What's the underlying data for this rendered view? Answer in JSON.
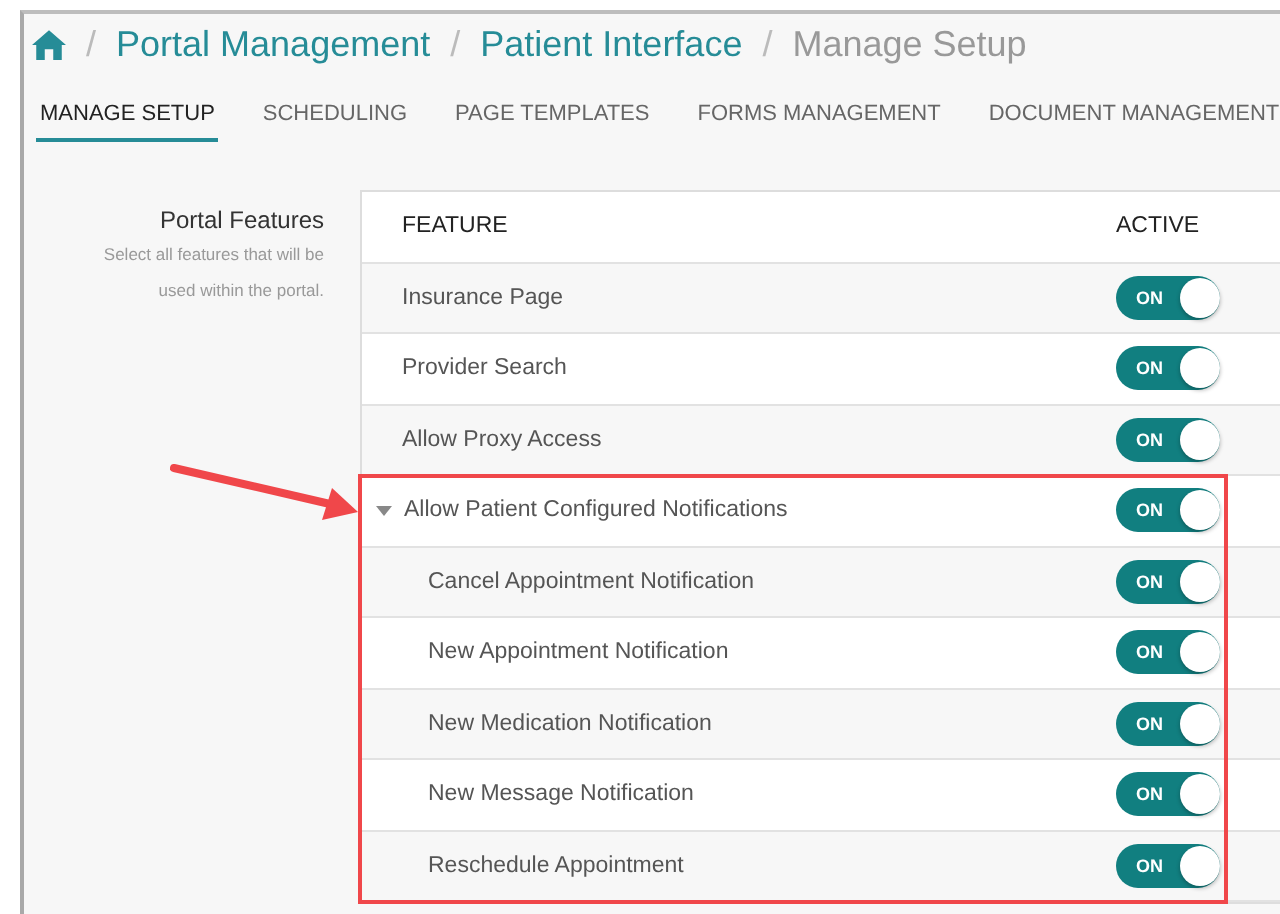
{
  "breadcrumb": {
    "items": [
      {
        "separator": "/",
        "label": "Portal Management",
        "selected": false
      },
      {
        "separator": "/",
        "label": "Patient Interface",
        "selected": false
      },
      {
        "separator": "/",
        "label": "Manage Setup",
        "selected": true
      }
    ]
  },
  "tabs": [
    {
      "label": "MANAGE SETUP",
      "selected": true
    },
    {
      "label": "SCHEDULING",
      "selected": false
    },
    {
      "label": "PAGE TEMPLATES",
      "selected": false
    },
    {
      "label": "FORMS MANAGEMENT",
      "selected": false
    },
    {
      "label": "DOCUMENT MANAGEMENT",
      "selected": false
    }
  ],
  "section": {
    "title": "Portal Features",
    "description": "Select all features that will be used within the portal."
  },
  "table": {
    "columns": [
      "FEATURE",
      "ACTIVE"
    ],
    "rows": [
      {
        "feature": "Insurance Page",
        "on": true,
        "toggle_label": "ON"
      },
      {
        "feature": "Provider Search",
        "on": true,
        "toggle_label": "ON"
      },
      {
        "feature": "Allow Proxy Access",
        "on": true,
        "toggle_label": "ON"
      },
      {
        "feature": "Allow Patient Configured Notifications",
        "on": true,
        "toggle_label": "ON",
        "expanded": true,
        "highlighted": true,
        "children": [
          {
            "feature": "Cancel Appointment Notification",
            "on": true,
            "toggle_label": "ON"
          },
          {
            "feature": "New Appointment Notification",
            "on": true,
            "toggle_label": "ON"
          },
          {
            "feature": "New Medication Notification",
            "on": true,
            "toggle_label": "ON"
          },
          {
            "feature": "New Message Notification",
            "on": true,
            "toggle_label": "ON"
          },
          {
            "feature": "Reschedule Appointment",
            "on": true,
            "toggle_label": "ON"
          }
        ]
      }
    ]
  }
}
